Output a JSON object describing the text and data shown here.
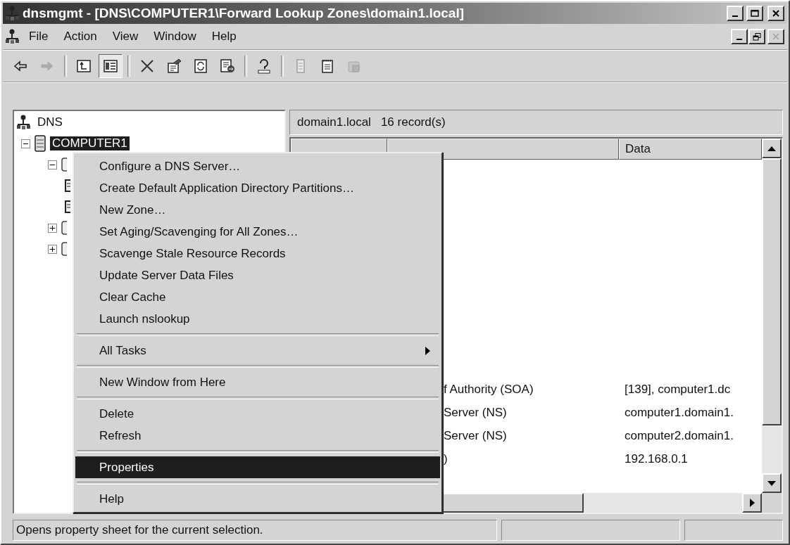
{
  "window": {
    "title": "dnsmgmt - [DNS\\COMPUTER1\\Forward Lookup Zones\\domain1.local]"
  },
  "menu_bar": [
    {
      "label": "File"
    },
    {
      "label": "Action"
    },
    {
      "label": "View"
    },
    {
      "label": "Window"
    },
    {
      "label": "Help"
    }
  ],
  "toolbar": [
    {
      "kind": "back",
      "disabled": false,
      "pressed": false
    },
    {
      "kind": "forward",
      "disabled": true,
      "pressed": false
    },
    {
      "kind": "separator"
    },
    {
      "kind": "up",
      "disabled": false,
      "pressed": false
    },
    {
      "kind": "tree",
      "disabled": false,
      "pressed": true
    },
    {
      "kind": "separator"
    },
    {
      "kind": "delete",
      "disabled": false,
      "pressed": false
    },
    {
      "kind": "properties",
      "disabled": false,
      "pressed": false
    },
    {
      "kind": "refresh",
      "disabled": false,
      "pressed": false
    },
    {
      "kind": "export",
      "disabled": false,
      "pressed": false
    },
    {
      "kind": "separator"
    },
    {
      "kind": "help",
      "disabled": false,
      "pressed": false
    },
    {
      "kind": "separator"
    },
    {
      "kind": "record",
      "disabled": true,
      "pressed": false
    },
    {
      "kind": "note",
      "disabled": false,
      "pressed": false
    },
    {
      "kind": "copy",
      "disabled": true,
      "pressed": false
    }
  ],
  "tree": [
    {
      "label": "DNS",
      "kind": "root",
      "selected": false,
      "children": [
        {
          "label": "COMPUTER1",
          "kind": "server",
          "expanded": true,
          "selected": true,
          "children": [
            {
              "kind": "folder",
              "expanded": true,
              "children": [
                {
                  "kind": "leaf"
                },
                {
                  "kind": "leaf"
                }
              ]
            },
            {
              "kind": "folder",
              "expanded": false
            },
            {
              "kind": "folder",
              "expanded": false
            }
          ]
        }
      ]
    }
  ],
  "details": {
    "zone": "domain1.local",
    "count": "16 record(s)",
    "columns": [
      "Data"
    ],
    "rows": [
      {
        "type": "f Authority (SOA)",
        "data": "[139], computer1.dc"
      },
      {
        "type": "Server (NS)",
        "data": "computer1.domain1."
      },
      {
        "type": "Server (NS)",
        "data": "computer2.domain1."
      },
      {
        "type": ")",
        "data": "192.168.0.1"
      }
    ]
  },
  "context_menu": [
    {
      "kind": "item",
      "label": "Configure a DNS Server…",
      "selected": false
    },
    {
      "kind": "item",
      "label": "Create Default Application Directory Partitions…",
      "selected": false
    },
    {
      "kind": "item",
      "label": "New Zone…",
      "selected": false
    },
    {
      "kind": "item",
      "label": "Set Aging/Scavenging for All Zones…",
      "selected": false
    },
    {
      "kind": "item",
      "label": "Scavenge Stale Resource Records",
      "selected": false
    },
    {
      "kind": "item",
      "label": "Update Server Data Files",
      "selected": false
    },
    {
      "kind": "item",
      "label": "Clear Cache",
      "selected": false
    },
    {
      "kind": "item",
      "label": "Launch nslookup",
      "selected": false
    },
    {
      "kind": "separator"
    },
    {
      "kind": "submenu",
      "label": "All Tasks",
      "selected": false
    },
    {
      "kind": "separator"
    },
    {
      "kind": "item",
      "label": "New Window from Here",
      "selected": false
    },
    {
      "kind": "separator"
    },
    {
      "kind": "item",
      "label": "Delete",
      "selected": false
    },
    {
      "kind": "item",
      "label": "Refresh",
      "selected": false
    },
    {
      "kind": "separator"
    },
    {
      "kind": "item",
      "label": "Properties",
      "selected": true
    },
    {
      "kind": "separator"
    },
    {
      "kind": "item",
      "label": "Help",
      "selected": false
    }
  ],
  "status_bar": {
    "text": "Opens property sheet for the current selection."
  }
}
